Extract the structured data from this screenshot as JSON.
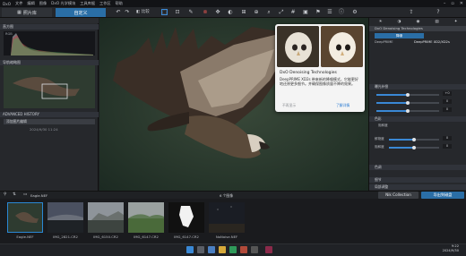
{
  "menubar": {
    "items": [
      "DxO",
      "文件",
      "编辑",
      "图像",
      "DxO 光学模块",
      "工具库据",
      "工作区",
      "帮助"
    ]
  },
  "toolbar": {
    "library_tab": "照片库",
    "custom_tab": "自定义",
    "compare_label": "比较"
  },
  "left_panel": {
    "histogram_header": "直方图",
    "nav_header": "导航缩略图",
    "history_header": "ADVANCED HISTORY",
    "history_item": "添加图片编辑",
    "history_date": "2024/9/30 11:24"
  },
  "popup": {
    "title": "DxO Denoising Technologies",
    "body": "DeepPRIME XD2s 带来新的降噪模式，它能更好地还原更多细节。并确保图像质量不降的效果。",
    "skip": "不再显示",
    "learn": "了解详情"
  },
  "right_panel": {
    "header_denoise": "DxO Denoising Technologies",
    "mode_label": "降噪",
    "option_a": "DeepPRIME",
    "option_b": "DeepPRIME XD2/XD2s",
    "section_exposure": "曝光补偿",
    "section_color": "色彩",
    "sub_vibrance": "饱和度",
    "label_vib": "鲜艳度",
    "label_sat": "饱和度",
    "section_tone": "色调",
    "section_detail": "细节",
    "section_local": "局部调整",
    "values": [
      "+0",
      "0",
      "0",
      "0",
      "0",
      "0"
    ]
  },
  "filmstrip": {
    "folder_path": "Eagle.NEF",
    "count_label": "6 个图像",
    "nik_button": "Nik Collection",
    "export_button": "导出到磁盘",
    "thumbs": [
      {
        "label": "Eagle.NEF"
      },
      {
        "label": "IMG_2821.CR2"
      },
      {
        "label": "IMG_6150.CR2"
      },
      {
        "label": "IMG_6147.CR2"
      },
      {
        "label": "IMG_6147.CR2"
      },
      {
        "label": "NoNoise.NEF"
      }
    ]
  },
  "taskbar": {
    "time": "9:22",
    "date": "2024/9/30"
  },
  "colors": {
    "accent": "#2a6ea6",
    "panel": "#26282c",
    "slider": "#3a88d5"
  }
}
